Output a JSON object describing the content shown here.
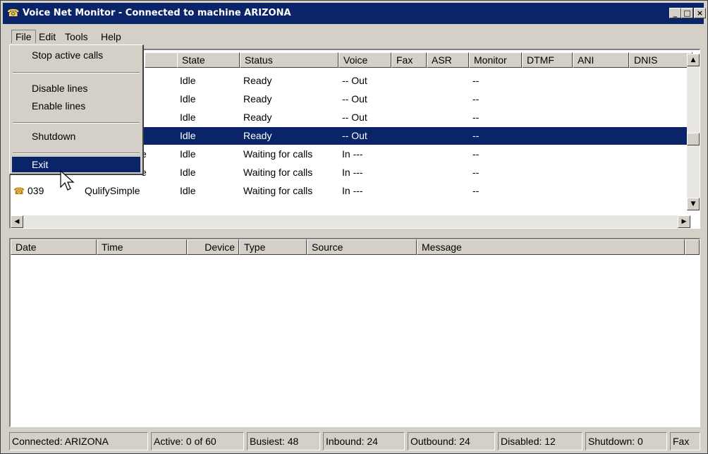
{
  "window": {
    "title": "Voice Net Monitor - Connected to machine ARIZONA",
    "icon": "phone-icon",
    "controls": [
      "_",
      "□",
      "×"
    ]
  },
  "menubar": [
    "File",
    "Edit",
    "Tools",
    "Help"
  ],
  "file_menu": [
    "Stop active calls",
    "Disable lines",
    "Enable lines",
    "Shutdown",
    "Exit"
  ],
  "lines_table": {
    "columns": [
      "State",
      "Status",
      "Voice",
      "Fax",
      "ASR",
      "Monitor",
      "DTMF",
      "ANI",
      "DNIS"
    ],
    "rows": [
      {
        "id": "",
        "app": "",
        "state": "Idle",
        "status": "Ready",
        "voice": "-- Out",
        "monitor": "--"
      },
      {
        "id": "",
        "app": "",
        "state": "Idle",
        "status": "Ready",
        "voice": "-- Out",
        "monitor": "--"
      },
      {
        "id": "",
        "app": "",
        "state": "Idle",
        "status": "Ready",
        "voice": "-- Out",
        "monitor": "--"
      },
      {
        "id": "",
        "app": "",
        "state": "Idle",
        "status": "Ready",
        "voice": "-- Out",
        "monitor": "--"
      },
      {
        "id": "",
        "app": "e",
        "state": "Idle",
        "status": "Waiting for calls",
        "voice": "In ---",
        "monitor": "--"
      },
      {
        "id": "",
        "app": "e",
        "state": "Idle",
        "status": "Waiting for calls",
        "voice": "In ---",
        "monitor": "--"
      },
      {
        "id": "039",
        "app": "QulifySimple",
        "state": "Idle",
        "status": "Waiting for calls",
        "voice": "In ---",
        "monitor": "--"
      }
    ],
    "selected_row": 3
  },
  "log_table": {
    "columns": [
      "Date",
      "Time",
      "Device",
      "Type",
      "Source",
      "Message"
    ]
  },
  "statusbar": [
    "Connected: ARIZONA",
    "Active: 0 of 60",
    "Busiest: 48",
    "Inbound: 24",
    "Outbound: 24",
    "Disabled: 12",
    "Shutdown: 0",
    "Fax"
  ],
  "colors": {
    "titlebar": "#0a246a",
    "face": "#d4d0c8",
    "selection": "#0a246a"
  }
}
